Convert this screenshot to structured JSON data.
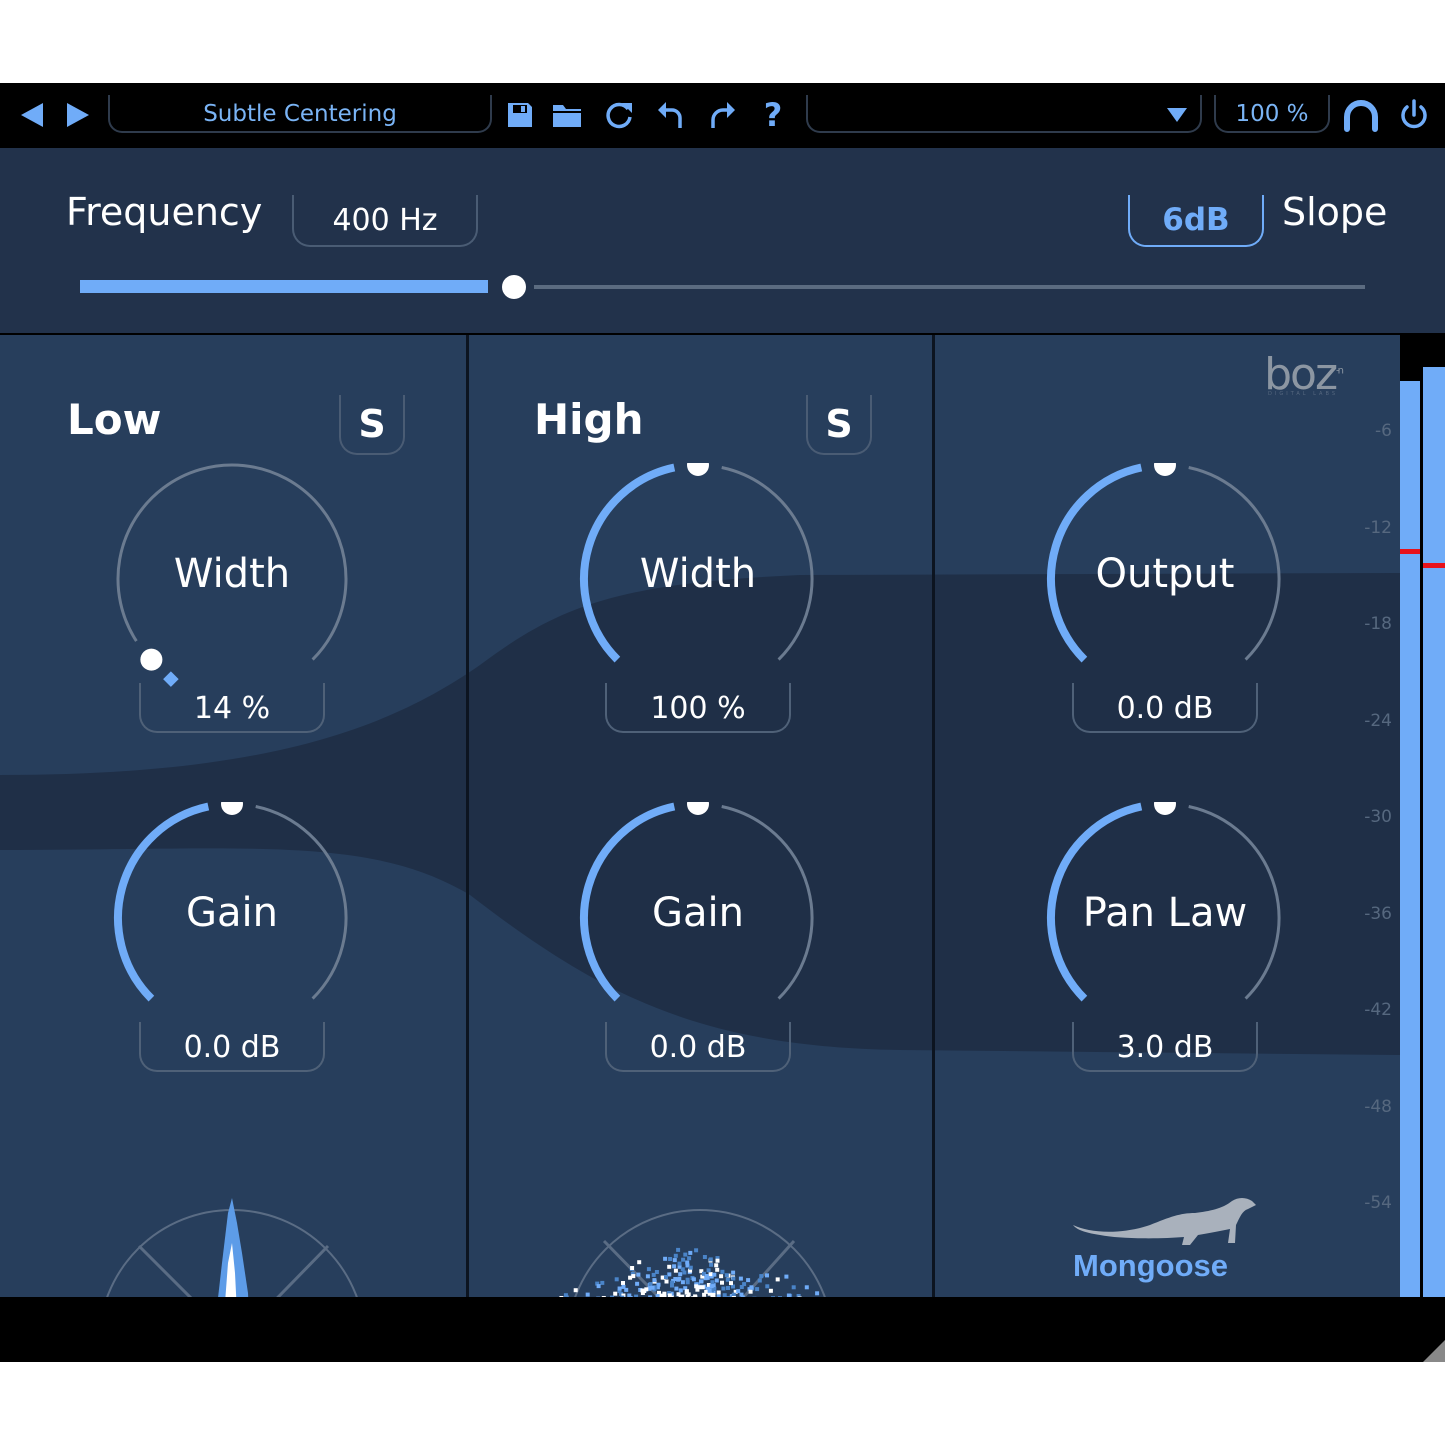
{
  "toolbar": {
    "prev_preset_icon": "triangle-left-icon",
    "next_preset_icon": "triangle-right-icon",
    "preset_name": "Subtle Centering",
    "icons": [
      "save-icon",
      "folder-icon",
      "reload-icon",
      "undo-icon",
      "redo-icon",
      "help-icon"
    ],
    "help_glyph": "?",
    "dropdown_value": "",
    "dropdown_icon": "triangle-down-icon",
    "zoom_level": "100 %",
    "headphone_icon": "headphones-icon",
    "power_icon": "power-icon"
  },
  "frequency": {
    "label": "Frequency",
    "value": "400 Hz",
    "slider_fraction": 0.335
  },
  "slope": {
    "value": "6dB",
    "label": "Slope"
  },
  "bands": [
    {
      "title": "Low",
      "solo_label": "S",
      "knobs": [
        {
          "label": "Width",
          "value": "14 %",
          "fraction": 0.0,
          "bipolar": false
        },
        {
          "label": "Gain",
          "value": "0.0 dB",
          "fraction": 0.5,
          "bipolar": false
        }
      ]
    },
    {
      "title": "High",
      "solo_label": "S",
      "knobs": [
        {
          "label": "Width",
          "value": "100 %",
          "fraction": 0.5,
          "bipolar": false
        },
        {
          "label": "Gain",
          "value": "0.0 dB",
          "fraction": 0.5,
          "bipolar": false
        }
      ]
    }
  ],
  "master": {
    "knobs": [
      {
        "label": "Output",
        "value": "0.0 dB",
        "fraction": 0.5
      },
      {
        "label": "Pan Law",
        "value": "3.0 dB",
        "fraction": 0.5
      }
    ],
    "product_name": "Mongoose",
    "brand_logo": "boz",
    "brand_sub": "DIGITAL LABS",
    "brand_sup": "-n"
  },
  "meter": {
    "scale": [
      "-6",
      "-12",
      "-18",
      "-24",
      "-30",
      "-36",
      "-42",
      "-48",
      "-54"
    ],
    "left_peak_db": -13,
    "right_peak_db": -14,
    "left_level_db": -0.5,
    "right_level_db": -1
  },
  "colors": {
    "accent": "#70acf8",
    "panel_bg": "#273e5c",
    "panel_dark": "#1f2f47",
    "peak": "#e8121b",
    "text": "#ffffff"
  }
}
